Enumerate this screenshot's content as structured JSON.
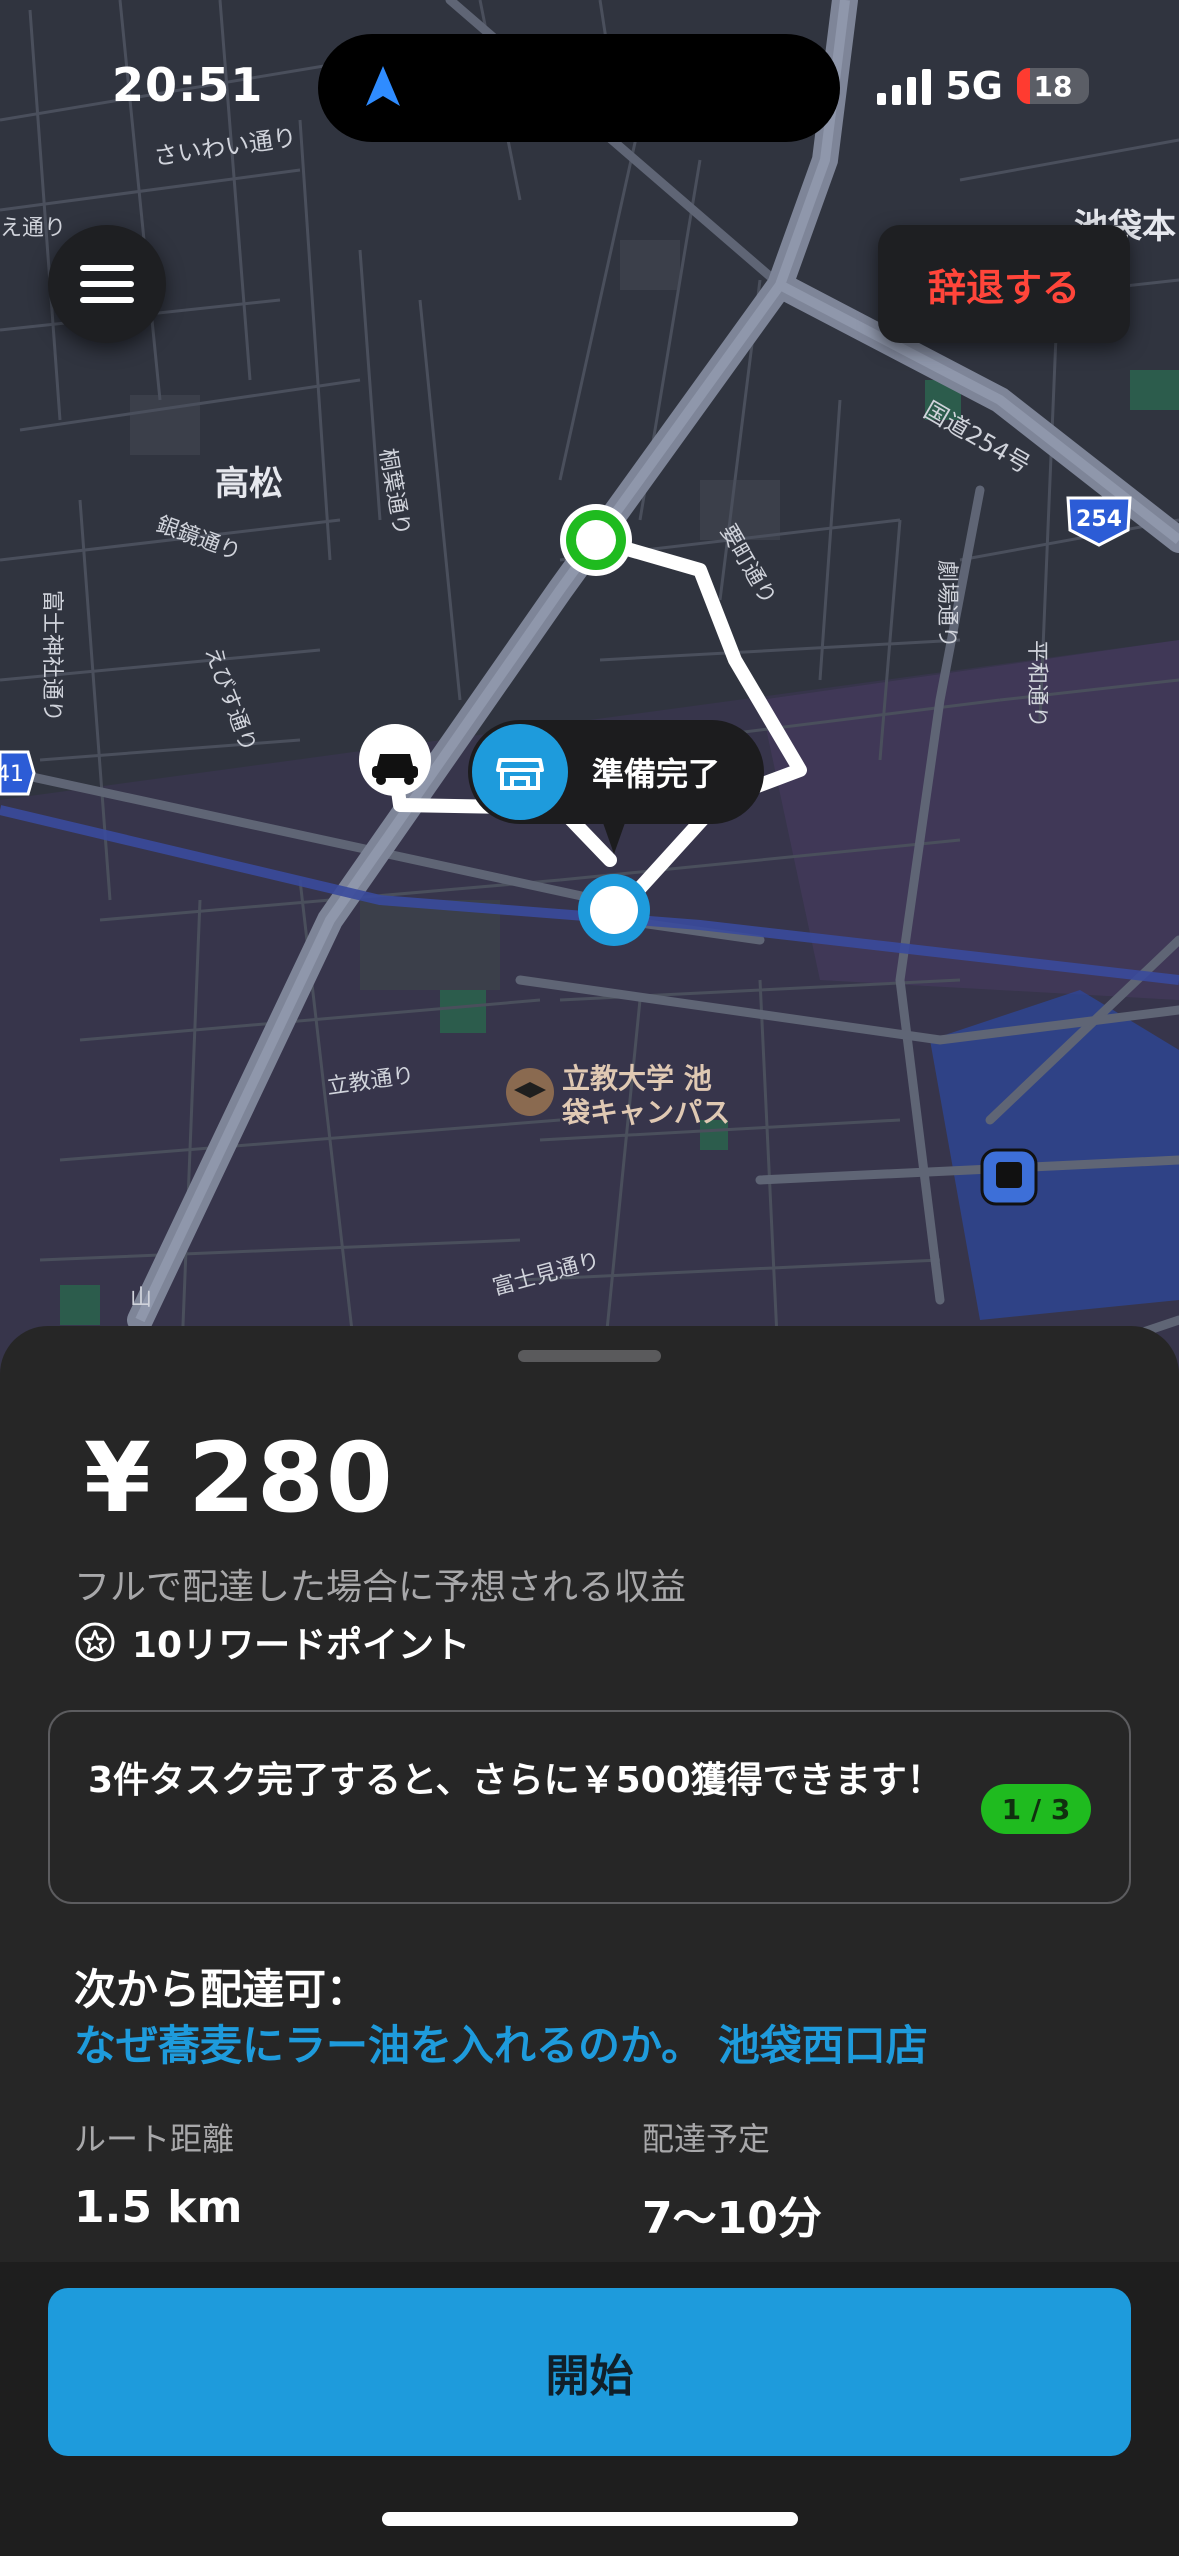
{
  "status_bar": {
    "time": "20:51",
    "network": "5G",
    "battery": "18",
    "battery_level": 0.18
  },
  "map": {
    "labels": [
      "さいわい通り",
      "高松",
      "桐葉通り",
      "銀鏡通り",
      "富士神社通り",
      "えびす通り",
      "要町通り",
      "劇場通り",
      "平和通り",
      "国道254号",
      "254",
      "立教通り",
      "富士見通り",
      "立教大学 池袋キャンパス",
      "池袋本",
      "41",
      "山",
      "え通り"
    ]
  },
  "controls": {
    "decline_label": "辞退する"
  },
  "store_callout": {
    "label": "準備完了"
  },
  "sheet": {
    "price": "¥ 280",
    "subtitle": "フルで配達した場合に予想される収益",
    "reward": "10リワードポイント",
    "promo": {
      "text": "3件タスク完了すると、さらに￥500獲得できます！",
      "badge": "1 / 3"
    },
    "from_label": "次から配達可：",
    "store_name": "なぜ蕎麦にラー油を入れるのか。 池袋西口店",
    "route_label": "ルート距離",
    "route_value": "1.5 km",
    "eta_label": "配達予定",
    "eta_value": "7〜10分"
  },
  "footer": {
    "start_label": "開始"
  },
  "colors": {
    "accent": "#1e9bdc",
    "decline": "#ff453a",
    "pickup": "#1fbb1f",
    "badge": "#1fbb1f"
  }
}
